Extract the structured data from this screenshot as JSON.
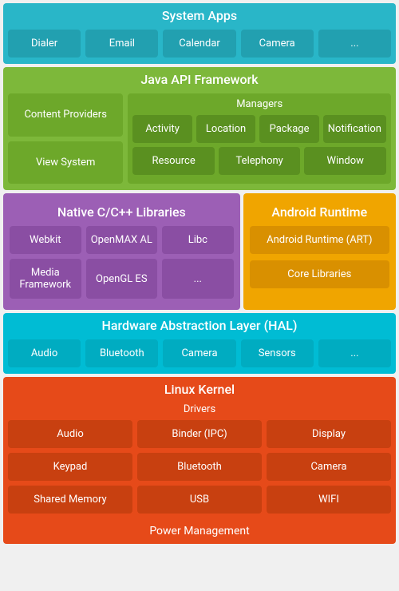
{
  "systemApps": {
    "title": "System Apps",
    "chips": [
      "Dialer",
      "Email",
      "Calendar",
      "Camera",
      "..."
    ]
  },
  "javaApi": {
    "title": "Java API Framework",
    "leftChips": [
      "Content Providers",
      "View System"
    ],
    "managersTitle": "Managers",
    "managerRow1": [
      "Activity",
      "Location",
      "Package",
      "Notification"
    ],
    "managerRow2": [
      "Resource",
      "Telephony",
      "Window"
    ]
  },
  "native": {
    "title": "Native C/C++ Libraries",
    "row1": [
      "Webkit",
      "OpenMAX AL",
      "Libc"
    ],
    "row2": [
      "Media Framework",
      "OpenGL ES",
      "..."
    ]
  },
  "androidRuntime": {
    "title": "Android Runtime",
    "chip1": "Android Runtime (ART)",
    "chip2": "Core Libraries"
  },
  "hal": {
    "title": "Hardware Abstraction Layer (HAL)",
    "chips": [
      "Audio",
      "Bluetooth",
      "Camera",
      "Sensors",
      "..."
    ]
  },
  "kernel": {
    "title": "Linux Kernel",
    "driversTitle": "Drivers",
    "row1": [
      "Audio",
      "Binder (IPC)",
      "Display"
    ],
    "row2": [
      "Keypad",
      "Bluetooth",
      "Camera"
    ],
    "row3": [
      "Shared Memory",
      "USB",
      "WIFI"
    ],
    "powerManagement": "Power Management"
  }
}
